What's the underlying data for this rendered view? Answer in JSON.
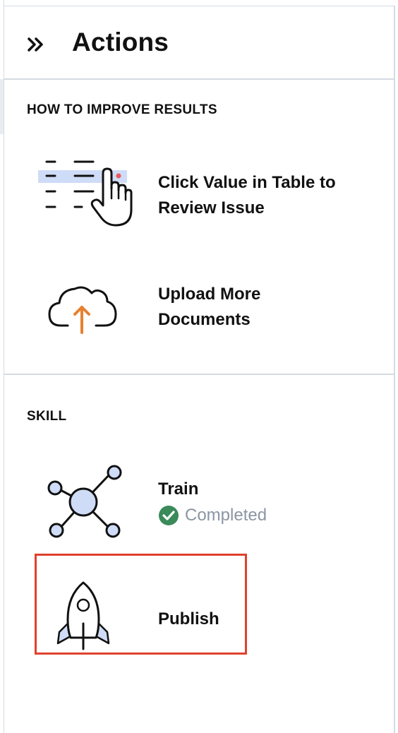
{
  "panel": {
    "title": "Actions",
    "collapse_icon": "double-chevron-right-icon"
  },
  "improve_section": {
    "label": "HOW TO IMPROVE RESULTS",
    "items": [
      {
        "icon": "table-click-icon",
        "line1": "Click Value in Table to",
        "line2": "Review Issue"
      },
      {
        "icon": "cloud-upload-icon",
        "line1": "Upload More",
        "line2": "Documents"
      }
    ]
  },
  "skill_section": {
    "label": "SKILL",
    "train": {
      "icon": "network-hub-icon",
      "label": "Train",
      "status": "Completed",
      "status_icon": "check-circle-icon"
    },
    "publish": {
      "icon": "rocket-icon",
      "label": "Publish"
    }
  },
  "colors": {
    "accent_orange": "#e8802e",
    "highlight_blue": "#cfdcf7",
    "success_green": "#3a8a5a",
    "highlight_border": "#e0412e",
    "muted_text": "#8b96a3",
    "divider": "#d5dbe1"
  }
}
